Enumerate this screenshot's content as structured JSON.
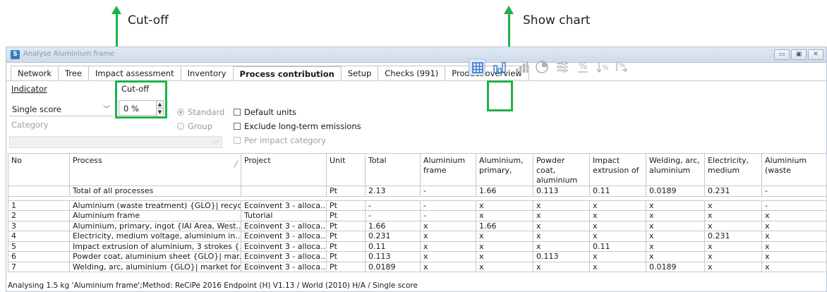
{
  "annotations": {
    "cutoff_label": "Cut-off",
    "show_chart_label": "Show chart",
    "accent_color": "#1fb14a"
  },
  "window": {
    "title": "Analyse Aluminium frame",
    "app_icon": "simapro-icon"
  },
  "tabs": [
    {
      "label": "Network"
    },
    {
      "label": "Tree"
    },
    {
      "label": "Impact assessment"
    },
    {
      "label": "Inventory"
    },
    {
      "label": "Process contribution",
      "active": true
    },
    {
      "label": "Setup"
    },
    {
      "label": "Checks (991)"
    },
    {
      "label": "Product overview"
    }
  ],
  "controls": {
    "indicator_label": "Indicator",
    "indicator_value": "Single score",
    "cutoff_label": "Cut-off",
    "cutoff_value": "0 %",
    "category_label": "Category",
    "radio_standard": "Standard",
    "radio_group": "Group",
    "check_default_units": "Default units",
    "check_exclude_long_term": "Exclude long-term emissions",
    "check_per_impact": "Per impact category"
  },
  "toolbar_icons": [
    "table-icon",
    "bar-chart-icon",
    "bar-chart-grey-icon",
    "pie-chart-icon",
    "filter-icon",
    "percent-icon",
    "sort-percent-desc-icon",
    "sort-percent-asc-icon"
  ],
  "table": {
    "headers": [
      "No",
      "Process",
      "Project",
      "Unit",
      "Total",
      "Aluminium frame",
      "Aluminium, primary,",
      "Powder coat, aluminium",
      "Impact extrusion of",
      "Welding, arc, aluminium",
      "Electricity, medium",
      "Aluminium (waste"
    ],
    "total_row": [
      "",
      "Total of all processes",
      "",
      "Pt",
      "2.13",
      "-",
      "1.66",
      "0.113",
      "0.11",
      "0.0189",
      "0.231",
      "-"
    ],
    "rows": [
      [
        "1",
        "Aluminium (waste treatment) {GLO}| recycl...",
        "Ecoinvent 3 - alloca...",
        "Pt",
        "-",
        "-",
        "x",
        "x",
        "x",
        "x",
        "x",
        "-"
      ],
      [
        "2",
        "Aluminium frame",
        "Tutorial",
        "Pt",
        "-",
        "-",
        "x",
        "x",
        "x",
        "x",
        "x",
        "x"
      ],
      [
        "3",
        "Aluminium, primary, ingot {IAI Area, West...",
        "Ecoinvent 3 - alloca...",
        "Pt",
        "1.66",
        "x",
        "1.66",
        "x",
        "x",
        "x",
        "x",
        "x"
      ],
      [
        "4",
        "Electricity, medium voltage, aluminium in...",
        "Ecoinvent 3 - alloca...",
        "Pt",
        "0.231",
        "x",
        "x",
        "x",
        "x",
        "x",
        "0.231",
        "x"
      ],
      [
        "5",
        "Impact extrusion of aluminium, 3 strokes {...",
        "Ecoinvent 3 - alloca...",
        "Pt",
        "0.11",
        "x",
        "x",
        "x",
        "0.11",
        "x",
        "x",
        "x"
      ],
      [
        "6",
        "Powder coat, aluminium sheet {GLO}| mar...",
        "Ecoinvent 3 - alloca...",
        "Pt",
        "0.113",
        "x",
        "x",
        "0.113",
        "x",
        "x",
        "x",
        "x"
      ],
      [
        "7",
        "Welding, arc, aluminium {GLO}| market for...",
        "Ecoinvent 3 - alloca...",
        "Pt",
        "0.0189",
        "x",
        "x",
        "x",
        "x",
        "0.0189",
        "x",
        "x"
      ]
    ]
  },
  "status": "Analysing 1.5 kg 'Aluminium frame';Method: ReCiPe 2016 Endpoint (H) V1.13 / World (2010) H/A / Single score"
}
